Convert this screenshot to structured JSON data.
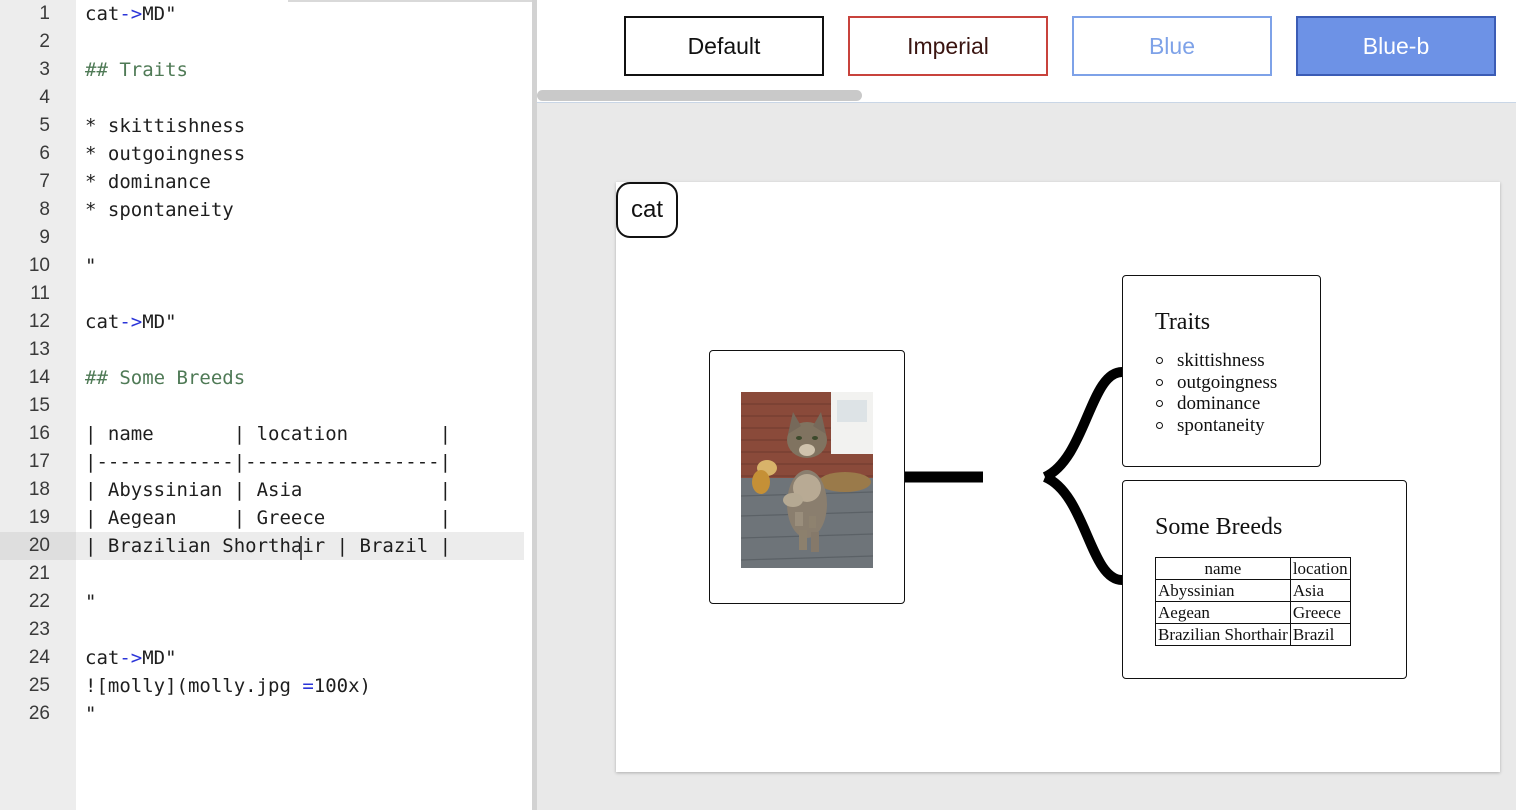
{
  "editor": {
    "active_line": 20,
    "lines": [
      [
        {
          "t": "cat"
        },
        {
          "t": "->",
          "c": "op"
        },
        {
          "t": "MD\""
        }
      ],
      [],
      [
        {
          "t": "## Traits",
          "c": "head"
        }
      ],
      [],
      [
        {
          "t": "* skittishness"
        }
      ],
      [
        {
          "t": "* outgoingness"
        }
      ],
      [
        {
          "t": "* dominance"
        }
      ],
      [
        {
          "t": "* spontaneity"
        }
      ],
      [],
      [
        {
          "t": "\""
        }
      ],
      [],
      [
        {
          "t": "cat"
        },
        {
          "t": "->",
          "c": "op"
        },
        {
          "t": "MD\""
        }
      ],
      [],
      [
        {
          "t": "## Some Breeds",
          "c": "head"
        }
      ],
      [],
      [
        {
          "t": "| name       | location        |"
        }
      ],
      [
        {
          "t": "|------------|-----------------|"
        }
      ],
      [
        {
          "t": "| Abyssinian | Asia            |"
        }
      ],
      [
        {
          "t": "| Aegean     | Greece          |"
        }
      ],
      [
        {
          "t": "| Brazilian Shorthair | Brazil |"
        }
      ],
      [],
      [
        {
          "t": "\""
        }
      ],
      [],
      [
        {
          "t": "cat"
        },
        {
          "t": "->",
          "c": "op"
        },
        {
          "t": "MD\""
        }
      ],
      [
        {
          "t": "![molly](molly.jpg "
        },
        {
          "t": "=",
          "c": "op"
        },
        {
          "t": "100x)"
        }
      ],
      [
        {
          "t": "\""
        }
      ]
    ]
  },
  "toolbar": {
    "default_label": "Default",
    "imperial_label": "Imperial",
    "blue_label": "Blue",
    "blueb_label": "Blue-b"
  },
  "mindmap": {
    "root_label": "cat",
    "image_alt": "molly",
    "traits": {
      "title": "Traits",
      "items": [
        "skittishness",
        "outgoingness",
        "dominance",
        "spontaneity"
      ]
    },
    "breeds": {
      "title": "Some Breeds",
      "headers": [
        "name",
        "location"
      ],
      "rows": [
        [
          "Abyssinian",
          "Asia"
        ],
        [
          "Aegean",
          "Greece"
        ],
        [
          "Brazilian Shorthair",
          "Brazil"
        ]
      ]
    }
  },
  "colors": {
    "op_token": "#2b35d8",
    "heading_token": "#4f7a56",
    "imperial_border": "#c8433c",
    "blue_outline": "#7ea2e8",
    "blueb_fill": "#6d92e6"
  }
}
